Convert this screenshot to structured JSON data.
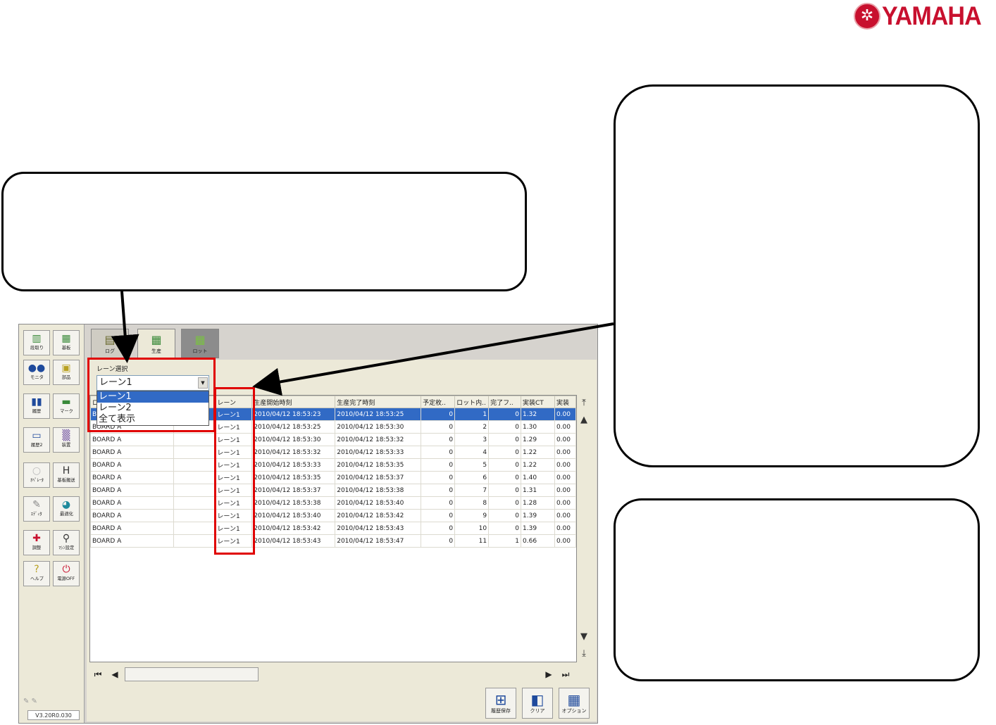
{
  "brand": {
    "logo_text": "YAMAHA",
    "accent": "#c8102e"
  },
  "sidebar": {
    "buttons": [
      {
        "label": "段取り",
        "icon": "setup-icon"
      },
      {
        "label": "基板",
        "icon": "board-icon"
      },
      {
        "label": "モニタ",
        "icon": "monitor-icon"
      },
      {
        "label": "部品",
        "icon": "parts-icon"
      },
      {
        "label": "履歴",
        "icon": "history-icon"
      },
      {
        "label": "マーク",
        "icon": "mark-icon"
      },
      {
        "label": "履歴2",
        "icon": "history2-icon"
      },
      {
        "label": "装置",
        "icon": "machine-icon"
      },
      {
        "label": "ｵﾍﾟﾚｰﾀ",
        "icon": "operator-icon"
      },
      {
        "label": "基板搬送",
        "icon": "conveyor-icon"
      },
      {
        "label": "ｴﾃﾞｨﾀ",
        "icon": "editor-icon"
      },
      {
        "label": "最適化",
        "icon": "optimize-icon"
      },
      {
        "label": "調整",
        "icon": "adjust-icon"
      },
      {
        "label": "ﾏｼﾝ設定",
        "icon": "machine-settings-icon"
      },
      {
        "label": "ヘルプ",
        "icon": "help-icon"
      },
      {
        "label": "電源OFF",
        "icon": "power-icon"
      }
    ],
    "version": "V3.20R0.030"
  },
  "tabs": [
    {
      "label": "ログ",
      "icon": "log-icon"
    },
    {
      "label": "生産",
      "icon": "production-icon"
    },
    {
      "label": "ロット",
      "icon": "lot-icon"
    }
  ],
  "lane": {
    "label": "レーン選択",
    "value": "レーン1",
    "options": [
      "レーン1",
      "レーン2",
      "全て表示"
    ]
  },
  "table": {
    "columns": [
      "ロット名",
      "",
      "レーン",
      "生産開始時刻",
      "生産完了時刻",
      "予定枚..",
      "ロット内..",
      "完了フ..",
      "実装CT",
      "実装"
    ],
    "rows": [
      [
        "BOARD A",
        "",
        "レーン1",
        "2010/04/12 18:53:23",
        "2010/04/12 18:53:25",
        "0",
        "1",
        "0",
        "1.32",
        "0.00"
      ],
      [
        "BOARD A",
        "",
        "レーン1",
        "2010/04/12 18:53:25",
        "2010/04/12 18:53:30",
        "0",
        "2",
        "0",
        "1.30",
        "0.00"
      ],
      [
        "BOARD A",
        "",
        "レーン1",
        "2010/04/12 18:53:30",
        "2010/04/12 18:53:32",
        "0",
        "3",
        "0",
        "1.29",
        "0.00"
      ],
      [
        "BOARD A",
        "",
        "レーン1",
        "2010/04/12 18:53:32",
        "2010/04/12 18:53:33",
        "0",
        "4",
        "0",
        "1.22",
        "0.00"
      ],
      [
        "BOARD A",
        "",
        "レーン1",
        "2010/04/12 18:53:33",
        "2010/04/12 18:53:35",
        "0",
        "5",
        "0",
        "1.22",
        "0.00"
      ],
      [
        "BOARD A",
        "",
        "レーン1",
        "2010/04/12 18:53:35",
        "2010/04/12 18:53:37",
        "0",
        "6",
        "0",
        "1.40",
        "0.00"
      ],
      [
        "BOARD A",
        "",
        "レーン1",
        "2010/04/12 18:53:37",
        "2010/04/12 18:53:38",
        "0",
        "7",
        "0",
        "1.31",
        "0.00"
      ],
      [
        "BOARD A",
        "",
        "レーン1",
        "2010/04/12 18:53:38",
        "2010/04/12 18:53:40",
        "0",
        "8",
        "0",
        "1.28",
        "0.00"
      ],
      [
        "BOARD A",
        "",
        "レーン1",
        "2010/04/12 18:53:40",
        "2010/04/12 18:53:42",
        "0",
        "9",
        "0",
        "1.39",
        "0.00"
      ],
      [
        "BOARD A",
        "",
        "レーン1",
        "2010/04/12 18:53:42",
        "2010/04/12 18:53:43",
        "0",
        "10",
        "0",
        "1.39",
        "0.00"
      ],
      [
        "BOARD A",
        "",
        "レーン1",
        "2010/04/12 18:53:43",
        "2010/04/12 18:53:47",
        "0",
        "11",
        "1",
        "0.66",
        "0.00"
      ]
    ]
  },
  "bottom_buttons": [
    {
      "label": "履歴保存",
      "icon": "save-history-icon"
    },
    {
      "label": "クリア",
      "icon": "clear-icon"
    },
    {
      "label": "オプション",
      "icon": "options-icon"
    }
  ],
  "colors": {
    "highlight": "#e00000",
    "selection": "#316ac5"
  }
}
